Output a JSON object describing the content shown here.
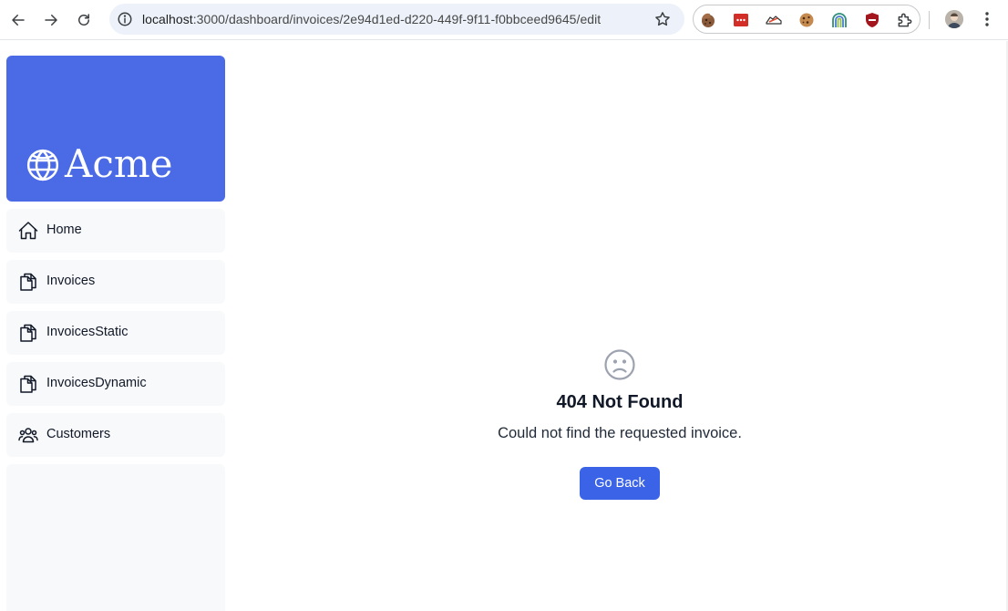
{
  "browser": {
    "url_host": "localhost",
    "url_path": ":3000/dashboard/invoices/2e94d1ed-d220-449f-9f11-f0bbceed9645/edit",
    "extensions": [
      "cookie-icon",
      "lastpass-icon",
      "sneaker-icon",
      "cookie-icon",
      "rainbow-icon",
      "ublock-icon",
      "puzzle-icon"
    ]
  },
  "sidebar": {
    "brand_name": "Acme",
    "brand_color": "#4a6ae6",
    "items": [
      {
        "label": "Home",
        "icon": "home-icon"
      },
      {
        "label": "Invoices",
        "icon": "document-duplicate-icon"
      },
      {
        "label": "InvoicesStatic",
        "icon": "document-duplicate-icon"
      },
      {
        "label": "InvoicesDynamic",
        "icon": "document-duplicate-icon"
      },
      {
        "label": "Customers",
        "icon": "user-group-icon"
      }
    ]
  },
  "main": {
    "icon": "face-frown-icon",
    "title": "404 Not Found",
    "message": "Could not find the requested invoice.",
    "button_label": "Go Back",
    "button_color": "#3b63e8"
  }
}
